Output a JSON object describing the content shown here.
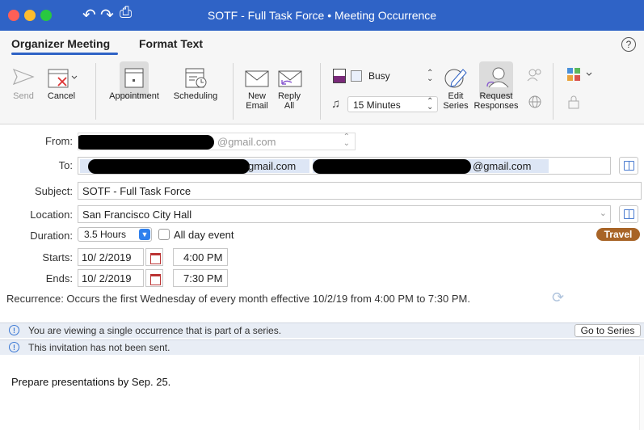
{
  "window": {
    "title": "SOTF - Full Task Force • Meeting Occurrence"
  },
  "tabs": {
    "active": "Organizer Meeting",
    "format": "Format Text",
    "help": "?"
  },
  "ribbon": {
    "send": "Send",
    "cancel": "Cancel",
    "appointment": "Appointment",
    "scheduling": "Scheduling",
    "new_email": "New Email",
    "reply_all": "Reply All",
    "show_as": "Busy",
    "reminder": "15 Minutes",
    "edit_series": "Edit Series",
    "request_responses": "Request Responses"
  },
  "form": {
    "from_label": "From:",
    "from_value": "@gmail.com",
    "to_label": "To:",
    "to_chip_1": "gmail.com",
    "to_chip_2": "@gmail.com",
    "subject_label": "Subject:",
    "subject_value": "SOTF - Full Task Force",
    "location_label": "Location:",
    "location_value": "San Francisco City Hall",
    "duration_label": "Duration:",
    "duration_value": "3.5 Hours",
    "all_day_label": "All day event",
    "travel_label": "Travel",
    "starts_label": "Starts:",
    "start_date": "10/  2/2019",
    "start_time": "4:00 PM",
    "ends_label": "Ends:",
    "end_date": "10/  2/2019",
    "end_time": "7:30 PM",
    "recurrence_text": "Recurrence: Occurs the first Wednesday of every month effective 10/2/19 from 4:00 PM to 7:30 PM."
  },
  "info": {
    "occurrence_notice": "You are viewing a single occurrence that is part of a series.",
    "go_to_series": "Go to Series",
    "not_sent_notice": "This invitation has not been sent.",
    "icon_glyph": "!"
  },
  "body": {
    "text": "Prepare presentations by Sep. 25."
  },
  "colors": {
    "titlebar": "#2f63c6",
    "travel": "#a86427",
    "chip": "#dde6f5",
    "infobar": "#e8edf5"
  }
}
